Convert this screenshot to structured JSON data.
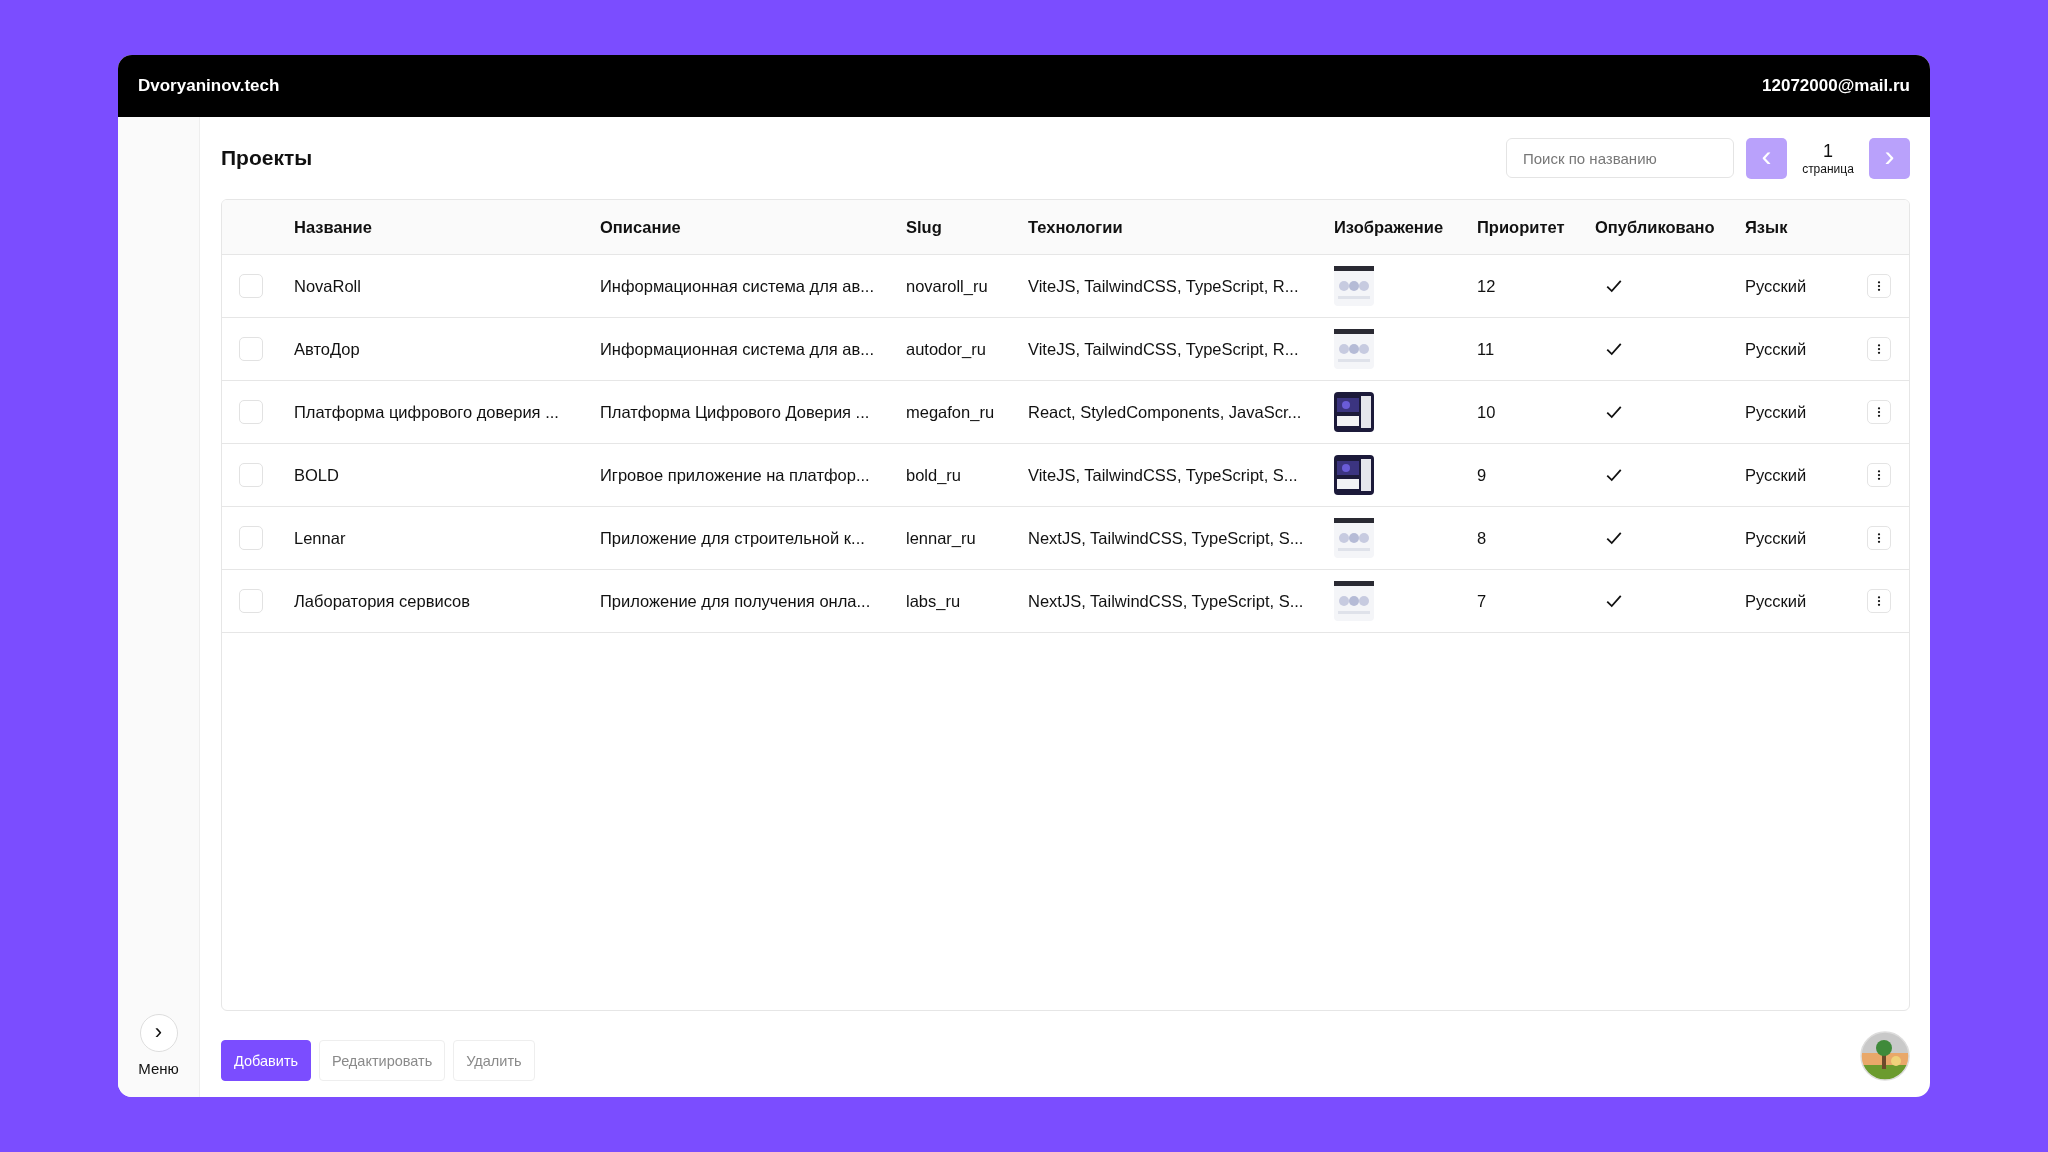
{
  "header": {
    "brand": "Dvoryaninov.tech",
    "email": "12072000@mail.ru"
  },
  "sidebar": {
    "toggle": "›",
    "menu_label": "Меню"
  },
  "page": {
    "title": "Проекты",
    "search": {
      "placeholder": "Поиск по названию"
    },
    "pagination": {
      "prev": {
        "icon": "‹",
        "disabled": true
      },
      "next": {
        "icon": "›",
        "disabled": true
      },
      "page": "1",
      "page_label": "страница"
    }
  },
  "table": {
    "columns": [
      "Название",
      "Описание",
      "Slug",
      "Технологии",
      "Изображение",
      "Приоритет",
      "Опубликовано",
      "Язык"
    ],
    "rows": [
      {
        "checked": false,
        "name": "NovaRoll",
        "description": "Информационная система для ав...",
        "slug": "novaroll_ru",
        "technologies": "ViteJS, TailwindCSS, TypeScript, R...",
        "priority": "12",
        "published": true,
        "language": "Русский"
      },
      {
        "checked": false,
        "name": "АвтоДор",
        "description": "Информационная система для ав...",
        "slug": "autodor_ru",
        "technologies": "ViteJS, TailwindCSS, TypeScript, R...",
        "priority": "11",
        "published": true,
        "language": "Русский"
      },
      {
        "checked": false,
        "name": "Платформа цифрового доверия ...",
        "description": "Платформа Цифрового Доверия ...",
        "slug": "megafon_ru",
        "technologies": "React, StyledComponents, JavaScr...",
        "priority": "10",
        "published": true,
        "language": "Русский"
      },
      {
        "checked": false,
        "name": "BOLD",
        "description": "Игровое приложение на платфор...",
        "slug": "bold_ru",
        "technologies": "ViteJS, TailwindCSS, TypeScript, S...",
        "priority": "9",
        "published": true,
        "language": "Русский"
      },
      {
        "checked": false,
        "name": "Lennar",
        "description": "Приложение для строительной к...",
        "slug": "lennar_ru",
        "technologies": "NextJS, TailwindCSS, TypeScript, S...",
        "priority": "8",
        "published": true,
        "language": "Русский"
      },
      {
        "checked": false,
        "name": "Лаборатория сервисов",
        "description": "Приложение для получения онла...",
        "slug": "labs_ru",
        "technologies": "NextJS, TailwindCSS, TypeScript, S...",
        "priority": "7",
        "published": true,
        "language": "Русский"
      }
    ]
  },
  "actions": [
    {
      "label": "Добавить",
      "kind": "primary",
      "disabled": false
    },
    {
      "label": "Редактировать",
      "kind": "secondary",
      "disabled": true
    },
    {
      "label": "Удалить",
      "kind": "secondary",
      "disabled": true
    }
  ]
}
